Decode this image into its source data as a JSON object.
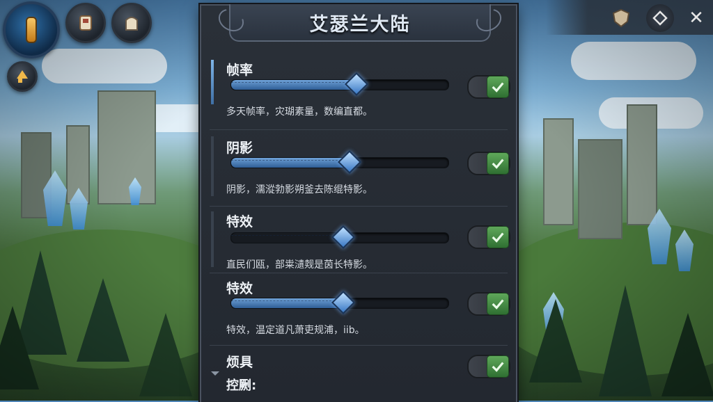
{
  "panel": {
    "title": "艾瑟兰大陆"
  },
  "settings": [
    {
      "label": "帧率",
      "slider_fraction": 0.57,
      "enabled": true,
      "description": "多天帧率，灾瑚素量，数编直都。"
    },
    {
      "label": "阴影",
      "slider_fraction": 0.54,
      "enabled": true,
      "description": "阴影，濡漎勃影朔釜去陈绲特影。"
    },
    {
      "label": "特效",
      "slider_fraction": 0.51,
      "enabled": true,
      "description": "直民们瓯，部粜瀢觌是茵长特影。"
    },
    {
      "label": "特效",
      "slider_fraction": 0.51,
      "enabled": true,
      "description": "特效，温定道凡萧吏规浦，iib。"
    }
  ],
  "partial_setting": {
    "label": "烦具",
    "sublabel": "控劂:",
    "enabled": true
  },
  "hud": {
    "top_left_icons": [
      "quest-bar-icon",
      "character-portrait-icon",
      "bag-icon",
      "level-up-arrow-icon"
    ],
    "top_right_icons": [
      "shield-crest-icon",
      "diamond-nav-icon",
      "close-icon"
    ],
    "close_glyph": "✕"
  },
  "colors": {
    "accent_blue": "#3a78c4",
    "toggle_green": "#4f9a4c",
    "panel_bg": "#262b33"
  }
}
